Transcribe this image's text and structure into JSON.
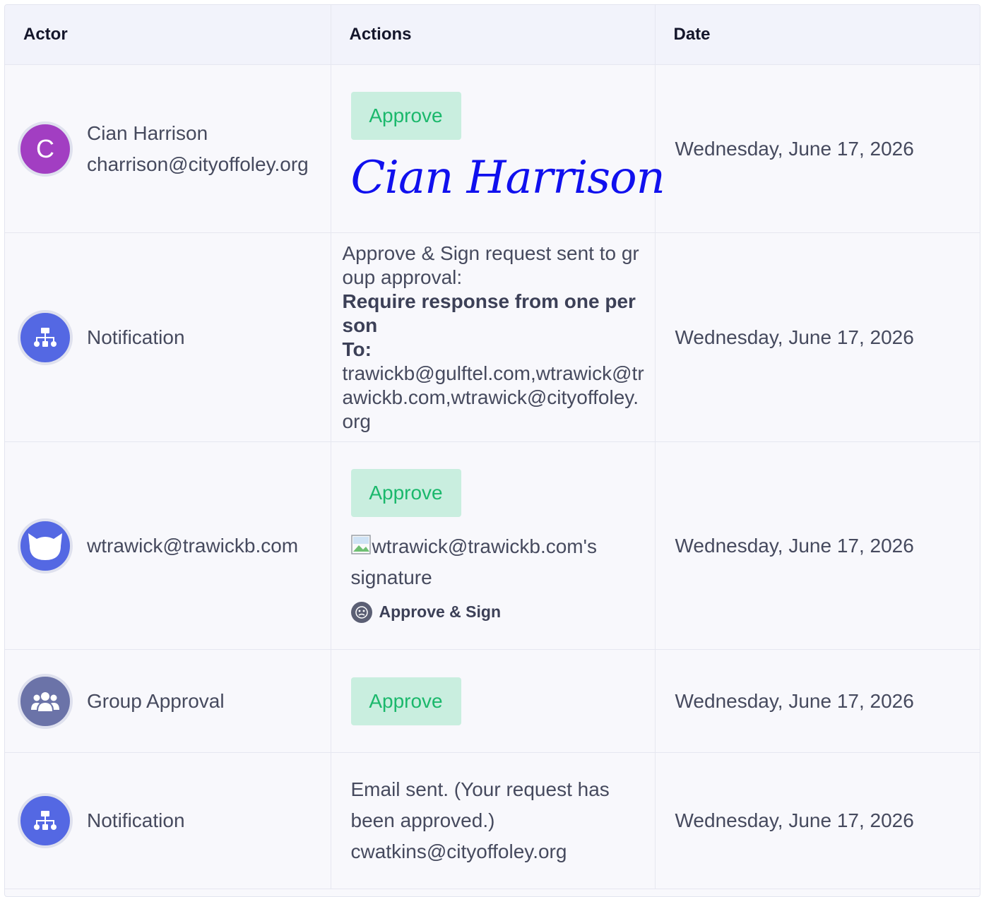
{
  "table": {
    "headers": {
      "actor": "Actor",
      "actions": "Actions",
      "date": "Date"
    },
    "rows": [
      {
        "avatar_letter": "C",
        "avatar_color": "#a23ec2",
        "actor_name": "Cian Harrison",
        "actor_email": "charrison@cityoffoley.org",
        "approve_label": "Approve",
        "signature_text": "Cian Harrison",
        "date": "Wednesday, June 17, 2026"
      },
      {
        "avatar_icon": "org-chart-icon",
        "avatar_color": "#5468e3",
        "actor_name": "Notification",
        "message_intro": "Approve & Sign request sent to group approval:",
        "message_bold": "Require response from one person",
        "message_to_label": "To:",
        "message_recipients": "trawickb@gulftel.com,wtrawick@trawickb.com,wtrawick@cityoffoley.org",
        "date": "Wednesday, June 17, 2026"
      },
      {
        "avatar_icon": "cat-icon",
        "avatar_color": "#5468e3",
        "actor_name": "wtrawick@trawickb.com",
        "approve_label": "Approve",
        "signature_alt": "wtrawick@trawickb.com's signature",
        "sign_method": "Approve & Sign",
        "date": "Wednesday, June 17, 2026"
      },
      {
        "avatar_icon": "users-icon",
        "avatar_color": "#6b73a8",
        "actor_name": "Group Approval",
        "approve_label": "Approve",
        "date": "Wednesday, June 17, 2026"
      },
      {
        "avatar_icon": "org-chart-icon",
        "avatar_color": "#5468e3",
        "actor_name": "Notification",
        "email_status": "Email sent. (Your request has been approved.)",
        "email_recipient": "cwatkins@cityoffoley.org",
        "date": "Wednesday, June 17, 2026"
      }
    ]
  }
}
